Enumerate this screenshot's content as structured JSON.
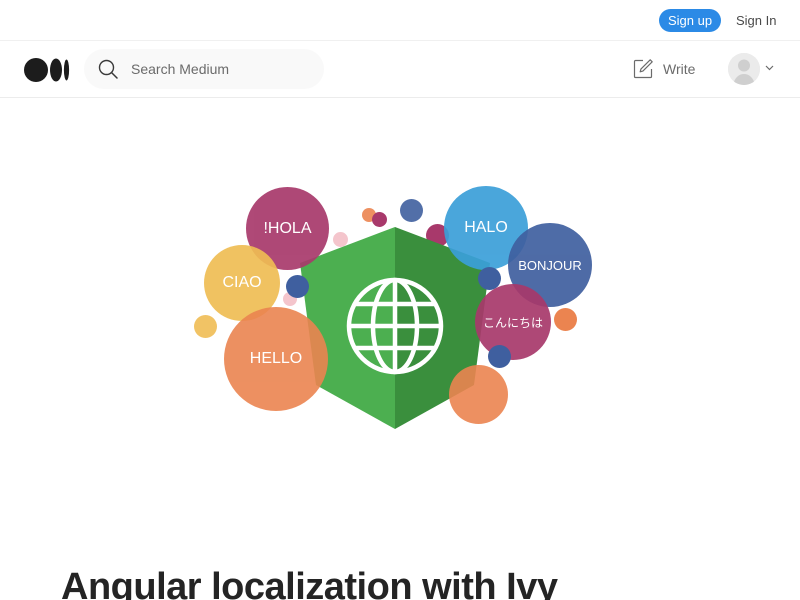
{
  "topbar": {
    "signup_label": "Sign up",
    "signin_label": "Sign In"
  },
  "header": {
    "logo_icon": "medium-logo-icon",
    "search": {
      "icon": "search-icon",
      "placeholder": "Search Medium",
      "value": ""
    },
    "write_label": "Write",
    "write_icon": "compose-icon",
    "avatar_icon": "default-avatar-icon",
    "chevron_icon": "chevron-down-icon"
  },
  "hero": {
    "greetings": {
      "hola": "!HOLA",
      "halo": "HALO",
      "ciao": "CIAO",
      "bonjour": "BONJOUR",
      "konnichiwa": "こんにちは",
      "hello": "HELLO"
    },
    "colors": {
      "shield_left": "#4caf50",
      "shield_right": "#3a8f3d",
      "purple": "#a8396b",
      "blue": "#3b9fd9",
      "navy": "#3f5f9f",
      "yellow": "#efbd54",
      "orange": "#eb8450",
      "pink": "#f4c5cc"
    }
  },
  "article": {
    "title": "Angular localization with Ivy"
  },
  "colors": {
    "accent": "#2b8ae6",
    "text": "#242424",
    "muted": "#6b6b6b"
  }
}
